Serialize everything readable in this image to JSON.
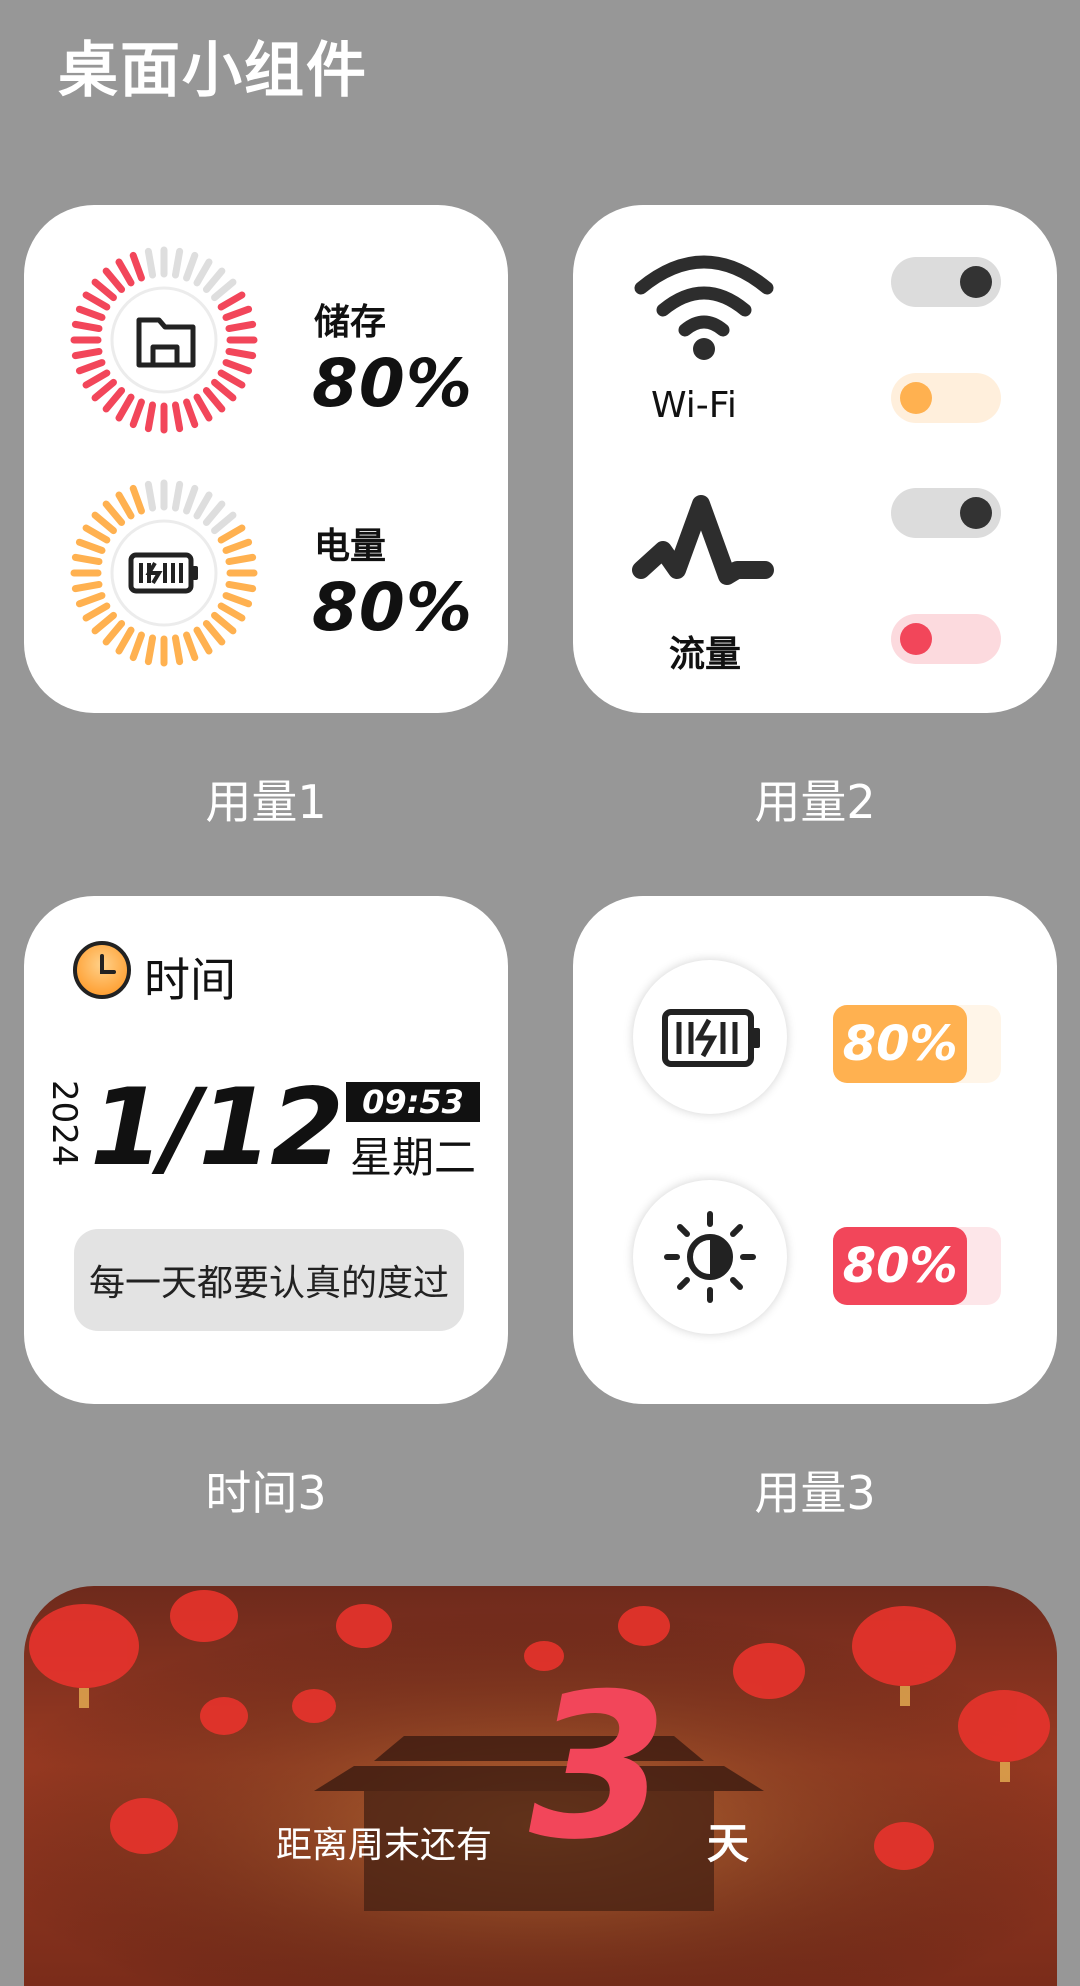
{
  "page": {
    "title": "桌面小组件"
  },
  "widgets": {
    "usage1": {
      "caption": "用量1",
      "storage": {
        "label": "储存",
        "value": "80%",
        "fraction": 0.8,
        "icon": "folder-icon",
        "color": "#f2465a"
      },
      "battery": {
        "label": "电量",
        "value": "80%",
        "fraction": 0.8,
        "icon": "battery-icon",
        "color": "#ffb150"
      }
    },
    "usage2": {
      "caption": "用量2",
      "wifi": {
        "label": "Wi-Fi",
        "icon": "wifi-icon"
      },
      "data": {
        "label": "流量",
        "icon": "pulse-icon"
      },
      "toggles": [
        {
          "state": "on",
          "color": "#333333"
        },
        {
          "state": "off",
          "color": "#ffb150"
        },
        {
          "state": "on",
          "color": "#333333"
        },
        {
          "state": "off",
          "color": "#f2465a"
        }
      ]
    },
    "time3": {
      "caption": "时间3",
      "header": "时间",
      "year": "2024",
      "date": "1/12",
      "time": "09:53",
      "weekday": "星期二",
      "quote": "每一天都要认真的度过"
    },
    "usage3": {
      "caption": "用量3",
      "battery": {
        "value": "80%",
        "fraction": 0.8,
        "color": "#ffb150",
        "icon": "battery-icon"
      },
      "brightness": {
        "value": "80%",
        "fraction": 0.8,
        "color": "#f2465a",
        "icon": "brightness-icon"
      }
    },
    "countdown": {
      "prefix": "距离周末还有",
      "number": "3",
      "suffix": "天",
      "accent": "#f2465a"
    }
  }
}
